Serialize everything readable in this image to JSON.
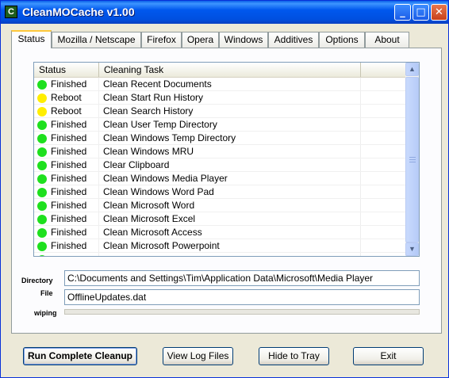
{
  "window": {
    "title": "CleanMOCache v1.00",
    "icon_letter": "C"
  },
  "tabs": [
    {
      "label": "Status",
      "active": true
    },
    {
      "label": "Mozilla / Netscape"
    },
    {
      "label": "Firefox"
    },
    {
      "label": "Opera"
    },
    {
      "label": "Windows"
    },
    {
      "label": "Additives"
    },
    {
      "label": "Options"
    },
    {
      "label": "About"
    }
  ],
  "list": {
    "headers": [
      "Status",
      "Cleaning Task"
    ],
    "rows": [
      {
        "status": "Finished",
        "state": "finished",
        "task": "Clean Recent Documents"
      },
      {
        "status": "Reboot",
        "state": "reboot",
        "task": "Clean Start Run History"
      },
      {
        "status": "Reboot",
        "state": "reboot",
        "task": "Clean Search History"
      },
      {
        "status": "Finished",
        "state": "finished",
        "task": "Clean User Temp Directory"
      },
      {
        "status": "Finished",
        "state": "finished",
        "task": "Clean Windows Temp Directory"
      },
      {
        "status": "Finished",
        "state": "finished",
        "task": "Clean Windows MRU"
      },
      {
        "status": "Finished",
        "state": "finished",
        "task": "Clear Clipboard"
      },
      {
        "status": "Finished",
        "state": "finished",
        "task": "Clean Windows Media Player"
      },
      {
        "status": "Finished",
        "state": "finished",
        "task": "Clean Windows Word Pad"
      },
      {
        "status": "Finished",
        "state": "finished",
        "task": "Clean Microsoft Word"
      },
      {
        "status": "Finished",
        "state": "finished",
        "task": "Clean Microsoft Excel"
      },
      {
        "status": "Finished",
        "state": "finished",
        "task": "Clean Microsoft Access"
      },
      {
        "status": "Finished",
        "state": "finished",
        "task": "Clean Microsoft Powerpoint"
      }
    ]
  },
  "status_colors": {
    "finished": "#1ee01e",
    "reboot": "#ffee00"
  },
  "fields": {
    "directory_label": "Directory",
    "directory_value": "C:\\Documents and Settings\\Tim\\Application Data\\Microsoft\\Media Player",
    "file_label": "File",
    "file_value": "OfflineUpdates.dat",
    "wiping_label": "wiping",
    "wiping_progress": 0
  },
  "buttons": {
    "run": "Run Complete Cleanup",
    "log": "View Log Files",
    "tray": "Hide to Tray",
    "exit": "Exit"
  },
  "icons": {
    "minimize": "minimize-icon",
    "maximize": "maximize-icon",
    "close": "close-icon",
    "scroll_up": "scroll-up-icon",
    "scroll_down": "scroll-down-icon"
  }
}
